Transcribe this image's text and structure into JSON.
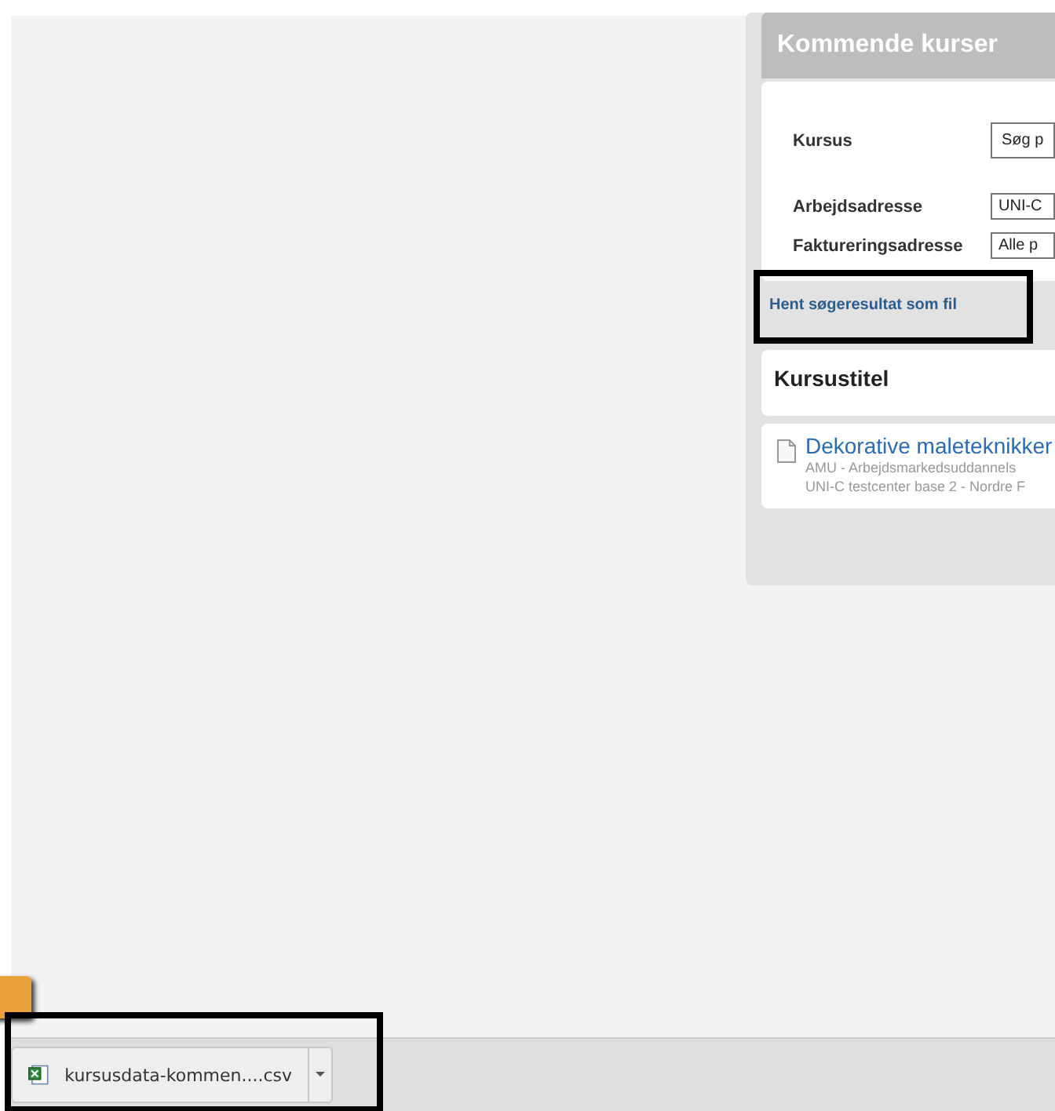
{
  "panel": {
    "title": "Kommende kurser",
    "form": [
      {
        "label": "Kursus",
        "value": "Søg p",
        "kind": "search"
      },
      {
        "label": "Arbejdsadresse",
        "value": "UNI-C",
        "kind": "select"
      },
      {
        "label": "Faktureringsadresse",
        "value": "Alle p",
        "kind": "select"
      }
    ],
    "export_link": "Hent søgeresultat som fil",
    "column_header": "Kursustitel",
    "results": [
      {
        "title": "Dekorative maleteknikker",
        "lines": [
          "AMU - Arbejdsmarkedsuddannels",
          "UNI-C testcenter base 2 - Nordre F"
        ]
      }
    ]
  },
  "download_bar": {
    "file": "kursusdata-kommen....csv"
  }
}
